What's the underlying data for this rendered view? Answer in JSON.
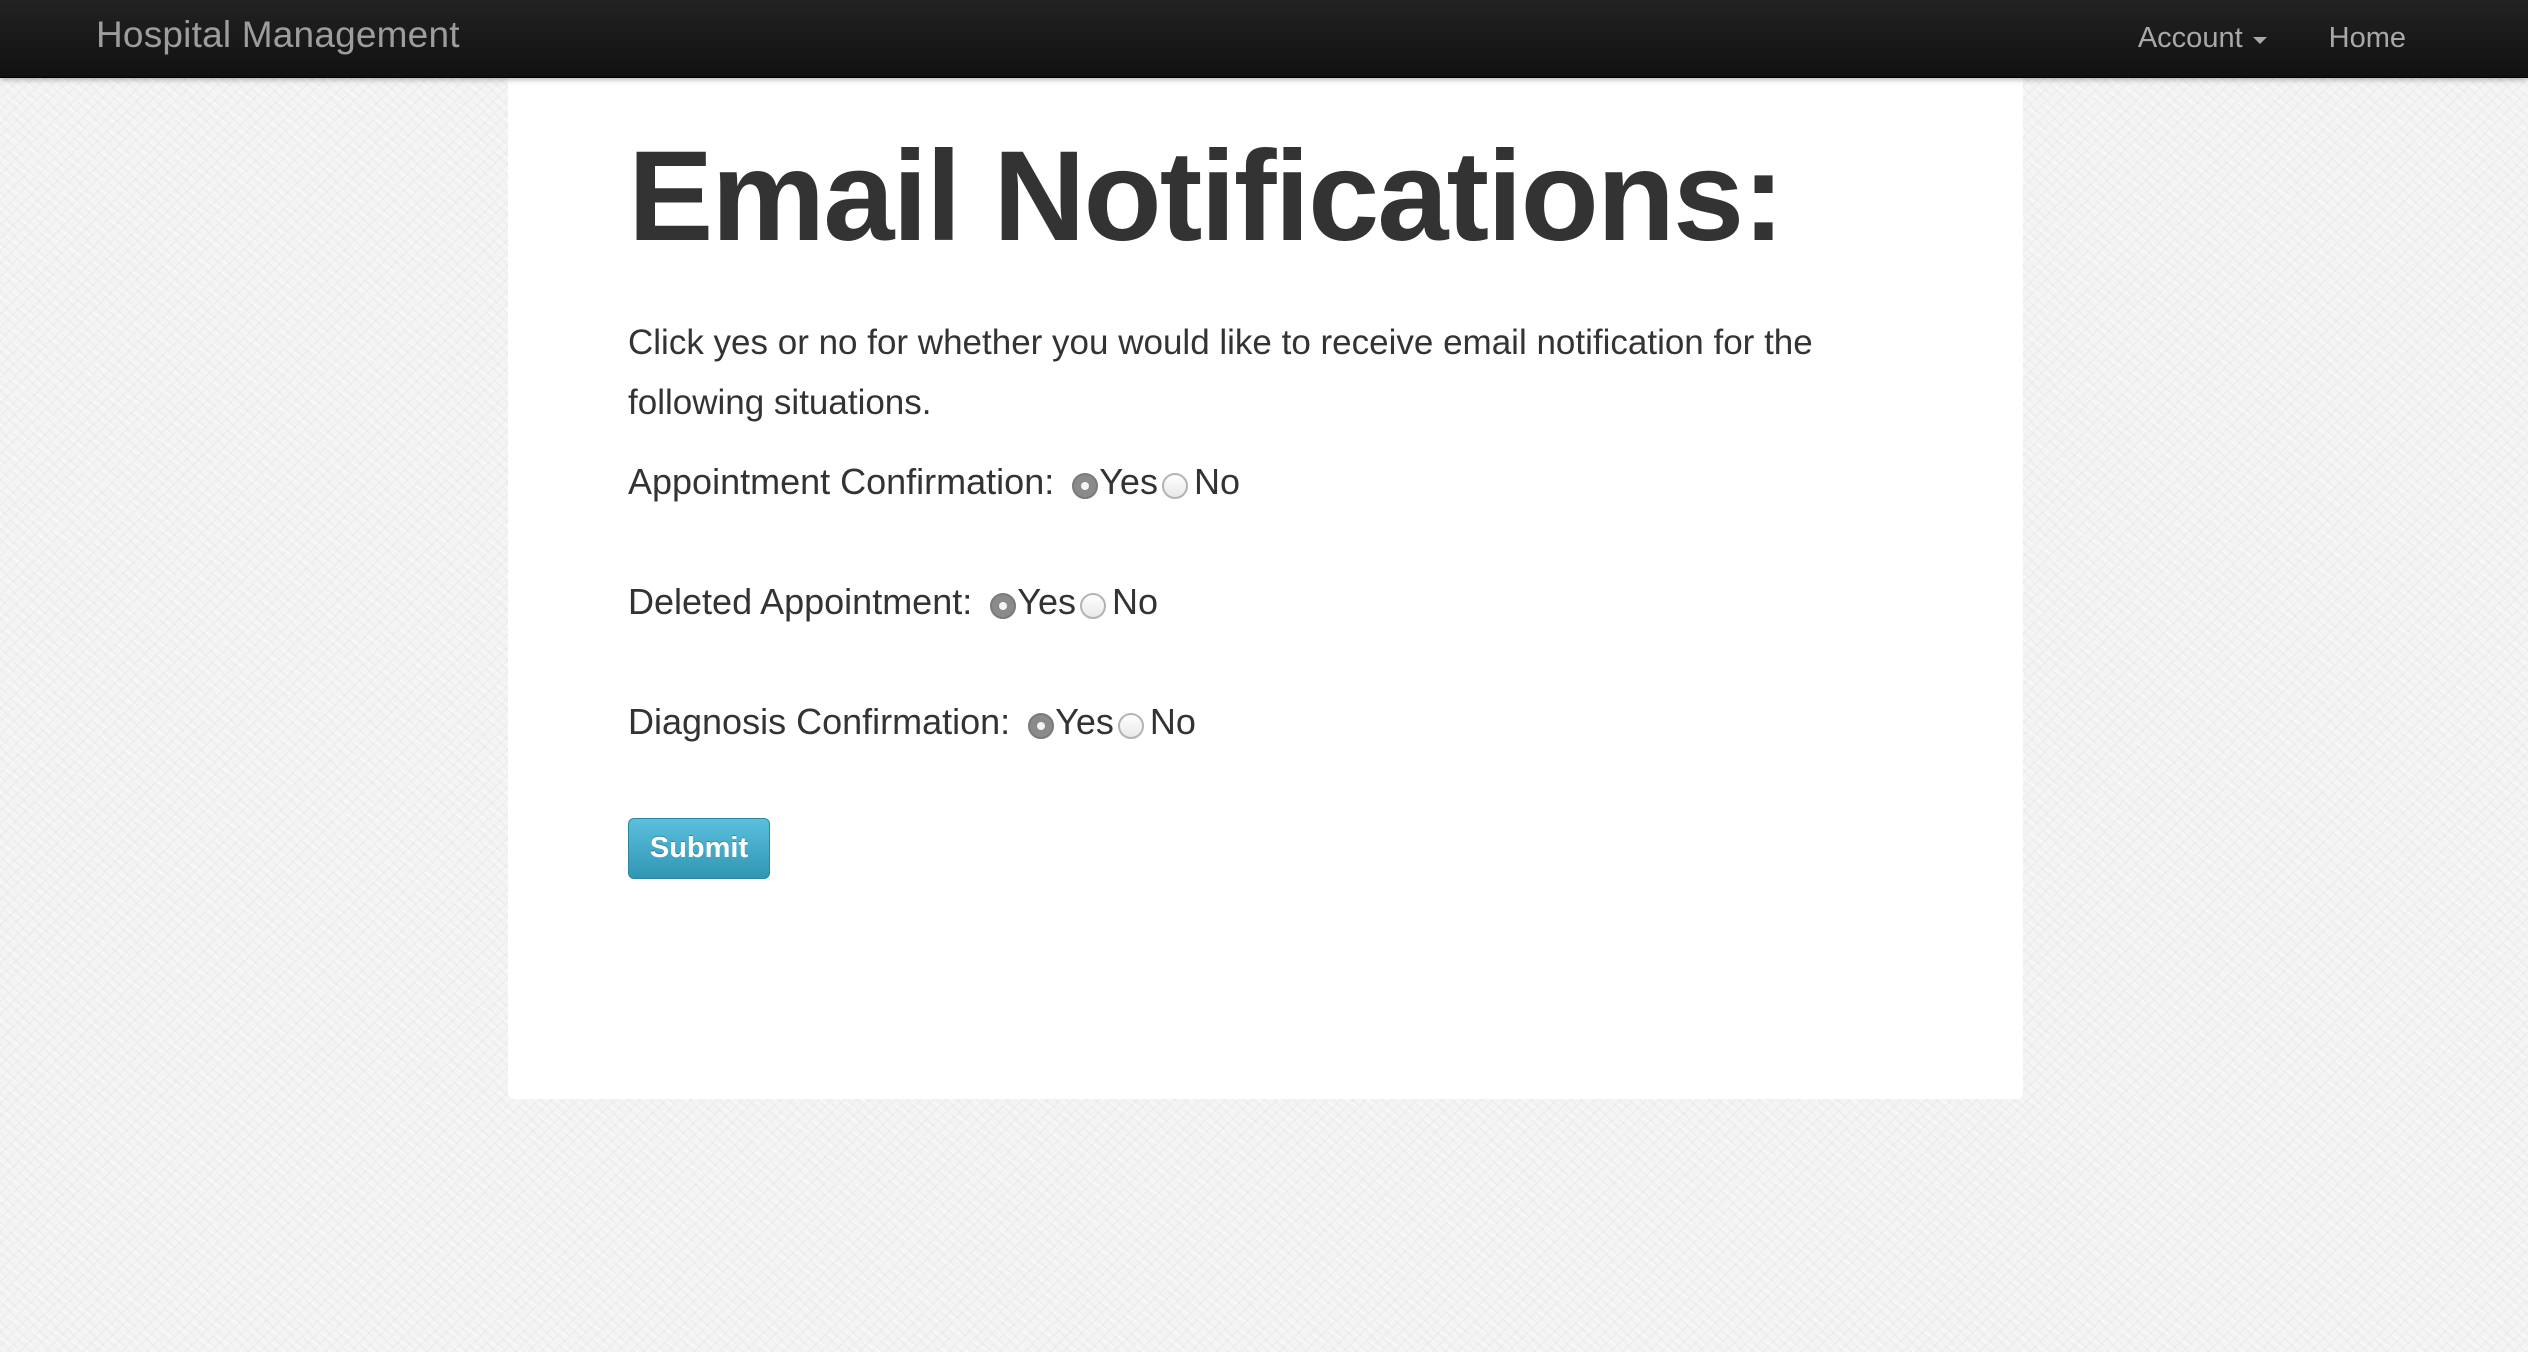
{
  "navbar": {
    "brand": "Hospital Management",
    "account_label": "Account",
    "home_label": "Home"
  },
  "main": {
    "title": "Email Notifications:",
    "intro": "Click yes or no for whether you would like to receive email notification for the following situations.",
    "options": [
      {
        "label": "Appointment Confirmation:",
        "yes": "Yes",
        "no": "No",
        "selected": "Yes"
      },
      {
        "label": "Deleted Appointment:",
        "yes": "Yes",
        "no": "No",
        "selected": "Yes"
      },
      {
        "label": "Diagnosis Confirmation:",
        "yes": "Yes",
        "no": "No",
        "selected": "Yes"
      }
    ],
    "submit_label": "Submit"
  },
  "colors": {
    "navbar": "#1a1a1a",
    "nav_text": "#a8a8a8",
    "button": "#49afcd",
    "text": "#333333"
  }
}
